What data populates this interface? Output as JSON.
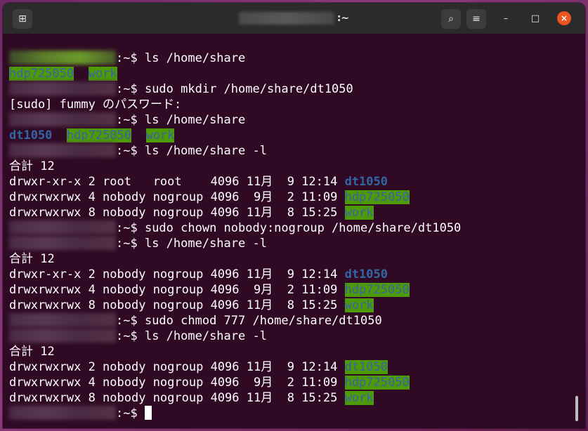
{
  "window": {
    "title_suffix": ":~",
    "colors": {
      "background": "#300a24",
      "titlebar": "#2b2b2b",
      "close": "#e95420",
      "dir_blue": "#3465a4",
      "dir_highlight": "#4e9a06"
    },
    "icons": {
      "new_tab": "new-tab-icon",
      "search": "search-icon",
      "menu": "hamburger-menu-icon",
      "minimize": "minimize-icon",
      "maximize": "maximize-icon",
      "close": "close-icon"
    },
    "new_tab_glyph": "⊞",
    "search_glyph": "⌕",
    "menu_glyph": "≡",
    "minimize_glyph": "–",
    "maximize_glyph": "□",
    "close_glyph": "×"
  },
  "prompt": ":~$",
  "lines": {
    "l1": {
      "cmd": " ls /home/share"
    },
    "l2": {
      "a": "hdp725050",
      "b": "work"
    },
    "l3": {
      "cmd": " sudo mkdir /home/share/dt1050"
    },
    "l4": {
      "text": "[sudo] fummy のパスワード:"
    },
    "l5": {
      "cmd": " ls /home/share"
    },
    "l6": {
      "a": "dt1050",
      "b": "hdp725050",
      "c": "work"
    },
    "l7": {
      "cmd": " ls /home/share -l"
    },
    "l8": {
      "text": "合計 12"
    },
    "l9": {
      "text": "drwxr-xr-x 2 root   root    4096 11月  9 12:14 ",
      "name": "dt1050"
    },
    "l10": {
      "text": "drwxrwxrwx 4 nobody nogroup 4096  9月  2 11:09 ",
      "name": "hdp725050"
    },
    "l11": {
      "text": "drwxrwxrwx 8 nobody nogroup 4096 11月  8 15:25 ",
      "name": "work"
    },
    "l12": {
      "cmd": " sudo chown nobody:nogroup /home/share/dt1050"
    },
    "l13": {
      "cmd": " ls /home/share -l"
    },
    "l14": {
      "text": "合計 12"
    },
    "l15": {
      "text": "drwxr-xr-x 2 nobody nogroup 4096 11月  9 12:14 ",
      "name": "dt1050"
    },
    "l16": {
      "text": "drwxrwxrwx 4 nobody nogroup 4096  9月  2 11:09 ",
      "name": "hdp725050"
    },
    "l17": {
      "text": "drwxrwxrwx 8 nobody nogroup 4096 11月  8 15:25 ",
      "name": "work"
    },
    "l18": {
      "cmd": " sudo chmod 777 /home/share/dt1050"
    },
    "l19": {
      "cmd": " ls /home/share -l"
    },
    "l20": {
      "text": "合計 12"
    },
    "l21": {
      "text": "drwxrwxrwx 2 nobody nogroup 4096 11月  9 12:14 ",
      "name": "dt1050"
    },
    "l22": {
      "text": "drwxrwxrwx 4 nobody nogroup 4096  9月  2 11:09 ",
      "name": "hdp725050"
    },
    "l23": {
      "text": "drwxrwxrwx 8 nobody nogroup 4096 11月  8 15:25 ",
      "name": "work"
    },
    "l24": {
      "cmd": " "
    }
  }
}
